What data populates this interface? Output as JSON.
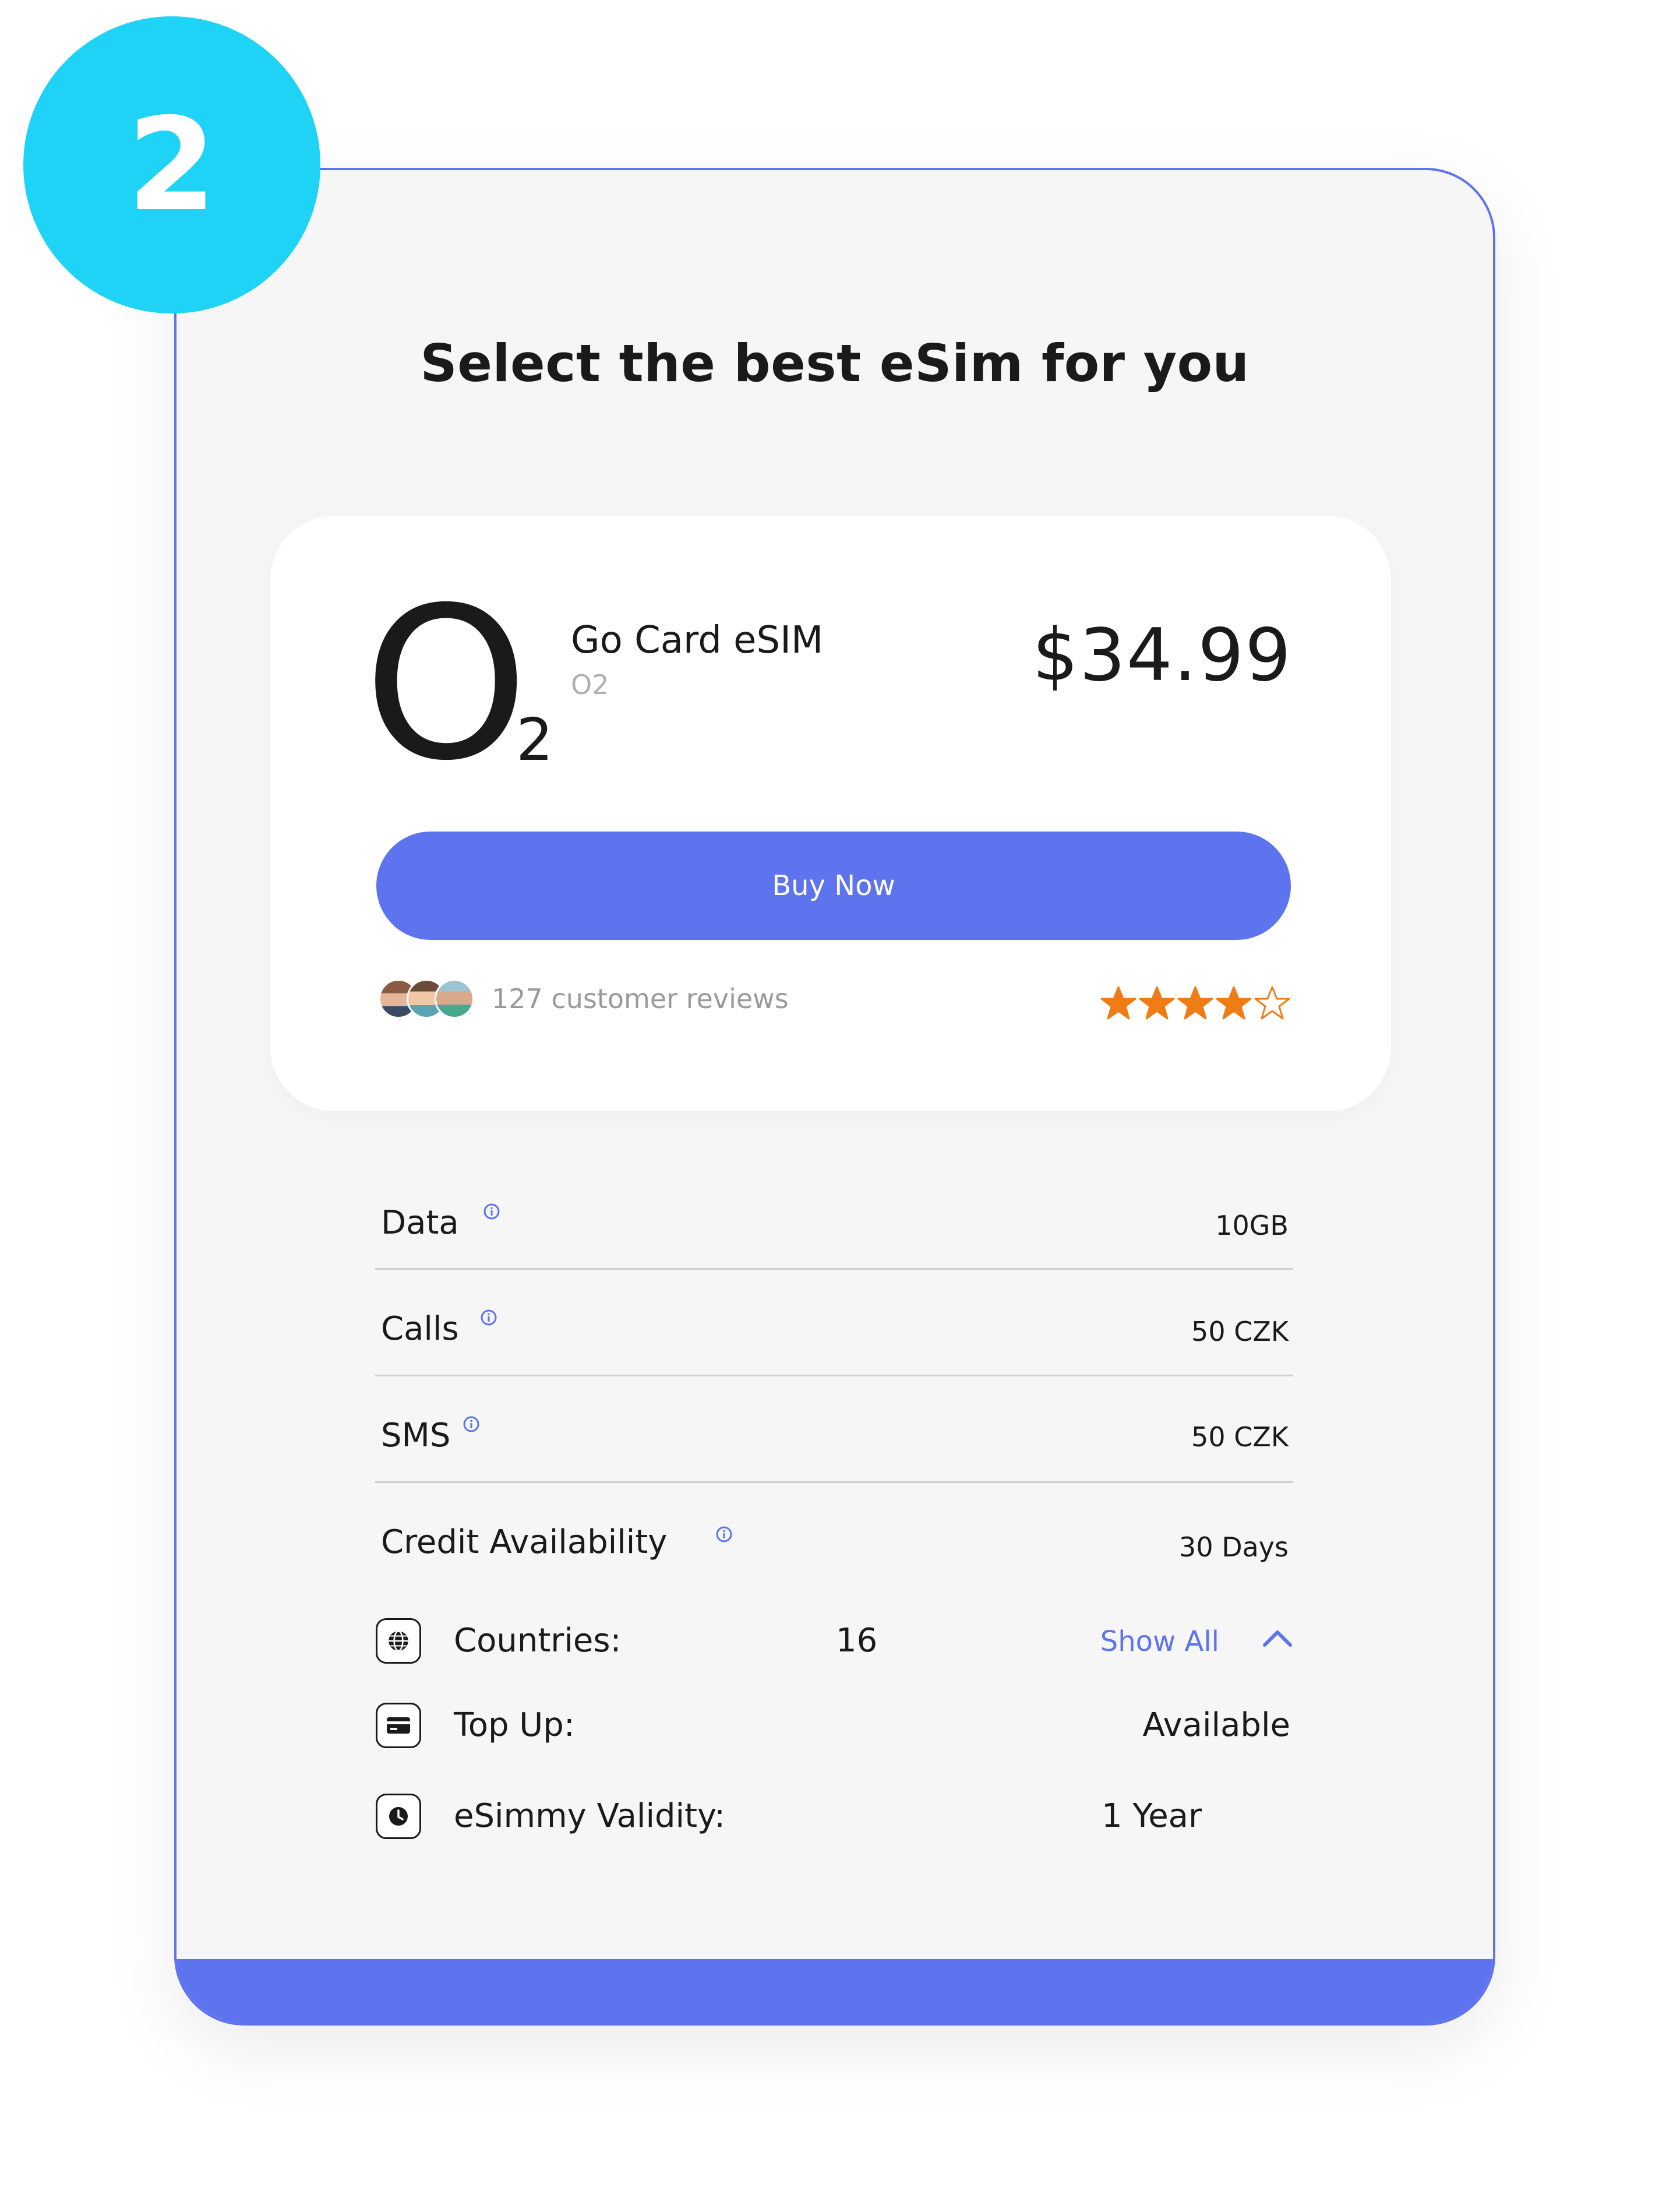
{
  "step": {
    "number": "2"
  },
  "page": {
    "title": "Select the best eSim for you"
  },
  "offer": {
    "logo": {
      "letter": "O",
      "subscript": "2"
    },
    "plan_name": "Go Card eSIM",
    "provider": "O2",
    "price": "$34.99",
    "buy_label": "Buy Now",
    "reviews_text": "127 customer reviews",
    "rating": 4,
    "rating_max": 5,
    "star_color": "#ef7c15"
  },
  "specs": [
    {
      "label": "Data",
      "value": "10GB"
    },
    {
      "label": "Calls",
      "value": "50 CZK"
    },
    {
      "label": "SMS",
      "value": "50 CZK"
    },
    {
      "label": "Credit Availability",
      "value": "30 Days"
    }
  ],
  "features": {
    "countries": {
      "label": "Countries:",
      "count": "16",
      "link": "Show All",
      "icon": "globe-icon"
    },
    "top_up": {
      "label": "Top Up:",
      "value": "Available",
      "icon": "credit-card-icon"
    },
    "validity": {
      "label": "eSimmy Validity:",
      "value": "1 Year",
      "icon": "clock-icon"
    }
  },
  "colors": {
    "accent": "#5e73ee",
    "badge": "#1ed3f6",
    "panel": "#f6f6f6"
  }
}
